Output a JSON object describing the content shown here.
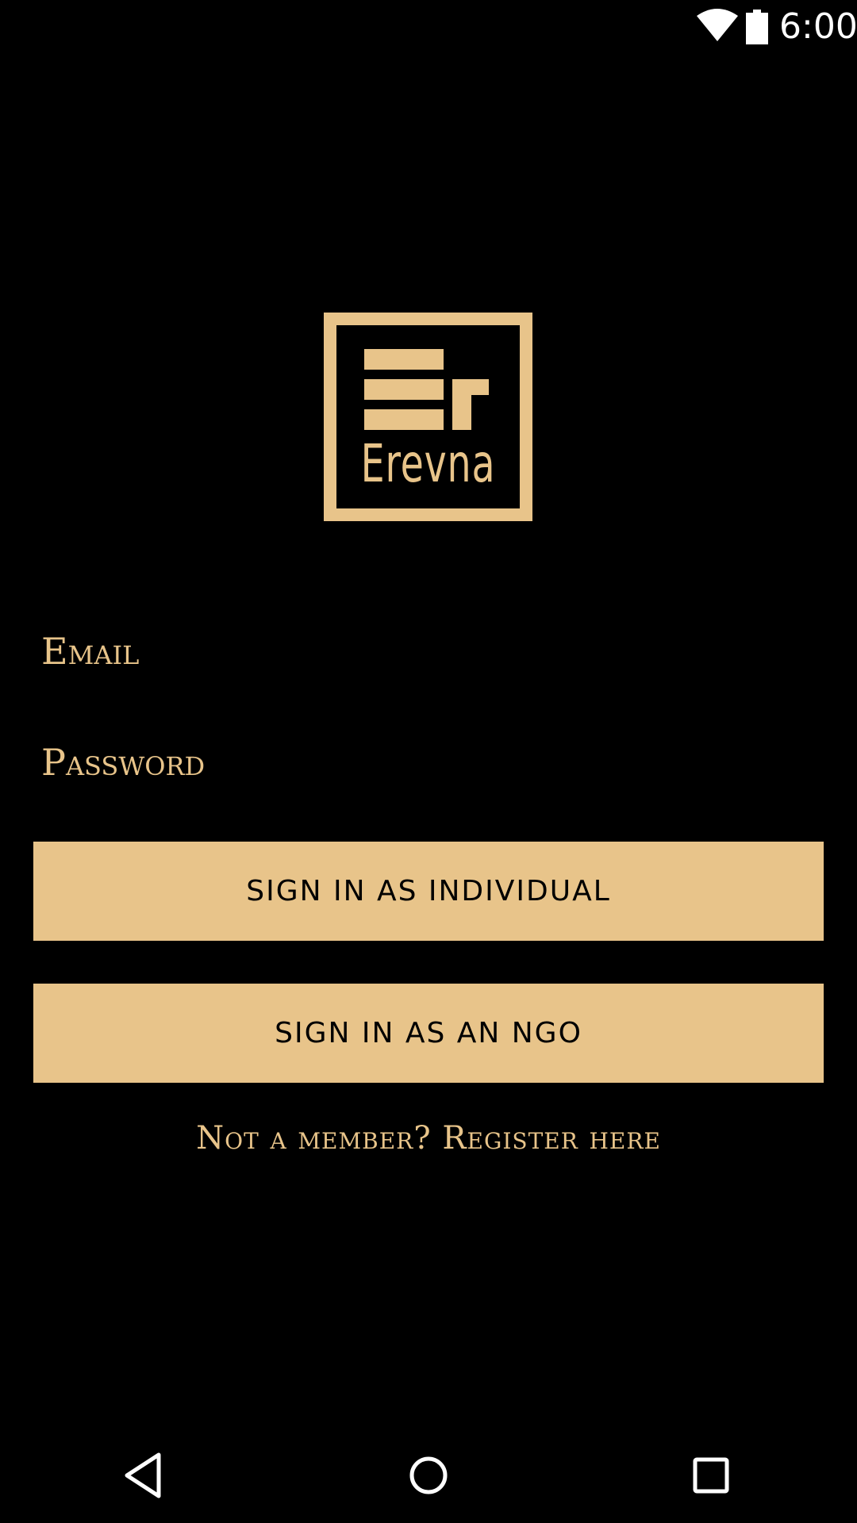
{
  "status_bar": {
    "time": "6:00",
    "icons": [
      "wifi-icon",
      "battery-icon"
    ]
  },
  "logo": {
    "text": "Erevna",
    "color": "#e8c48a"
  },
  "form": {
    "email_placeholder": "Email",
    "password_placeholder": "Password"
  },
  "buttons": {
    "individual": "SIGN IN AS INDIVIDUAL",
    "ngo": "SIGN IN AS AN NGO"
  },
  "register_text": "Not a member? Register here",
  "nav_bar": {
    "icons": [
      "back-icon",
      "home-icon",
      "recents-icon"
    ]
  },
  "colors": {
    "background": "#000000",
    "accent": "#e8c48a",
    "button_text": "#000000"
  }
}
